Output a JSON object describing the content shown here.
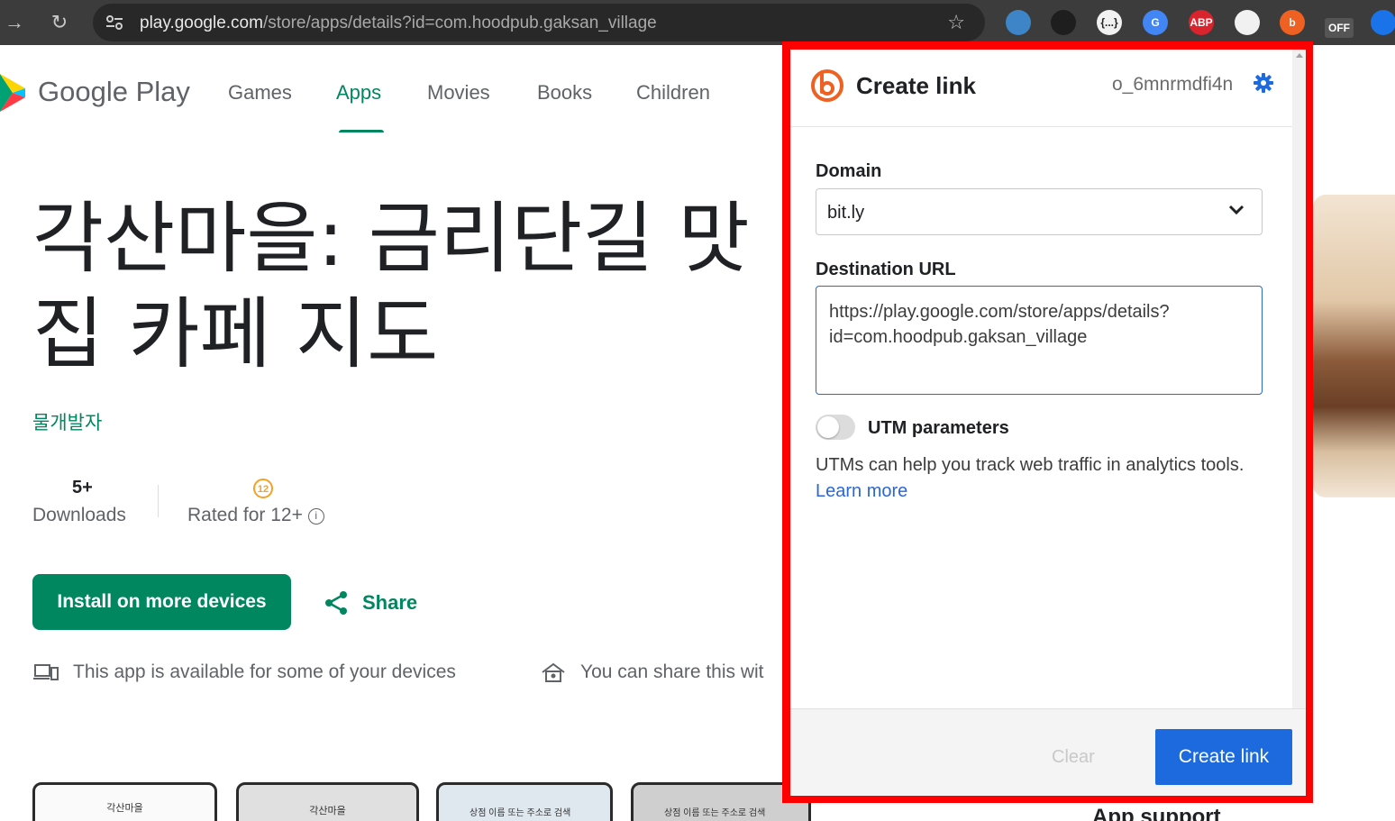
{
  "browser": {
    "url_host": "play.google.com",
    "url_path": "/store/apps/details?id=com.hoodpub.gaksan_village",
    "extensions": [
      {
        "name": "speed-dial-icon",
        "label": "",
        "color": "#3d85c6"
      },
      {
        "name": "bear-paw-icon",
        "label": "",
        "color": "#1e1e1e"
      },
      {
        "name": "json-viewer-icon",
        "label": "{...}",
        "color": "#f1f1f1"
      },
      {
        "name": "google-translate-icon",
        "label": "G",
        "color": "#4285f4"
      },
      {
        "name": "adblock-plus-icon",
        "label": "ABP",
        "color": "#d9232d"
      },
      {
        "name": "tab-manager-icon",
        "label": "",
        "color": "#f1f1f1"
      },
      {
        "name": "bitly-extension-icon",
        "label": "b",
        "color": "#ee6123"
      },
      {
        "name": "off-toggle-icon",
        "label": "OFF",
        "color": "#555555"
      },
      {
        "name": "blue-globe-icon",
        "label": "",
        "color": "#1a73e8"
      }
    ]
  },
  "play": {
    "brand": "Google Play",
    "nav": [
      "Games",
      "Apps",
      "Movies",
      "Books",
      "Children"
    ],
    "active_nav": "Apps"
  },
  "app": {
    "title": "각산마을: 금리단길 맛집 카페 지도",
    "developer": "물개발자",
    "downloads_value": "5+",
    "downloads_label": "Downloads",
    "rating_badge": "12",
    "rating_label": "Rated for 12+",
    "install_label": "Install on more devices",
    "share_label": "Share",
    "devices_note": "This app is available for some of your devices",
    "family_note": "You can share this wit",
    "app_support": "App support",
    "screenshots": [
      {
        "header": "각산마을"
      },
      {
        "header": "각산마을"
      },
      {
        "header": "상점 이름 또는 주소로 검색"
      },
      {
        "header": "상점 이름 또는 주소로 검색"
      }
    ]
  },
  "popup": {
    "title": "Create link",
    "account": "o_6mnrmdfi4n",
    "domain_label": "Domain",
    "domain_value": "bit.ly",
    "destination_label": "Destination URL",
    "destination_value": "https://play.google.com/store/apps/details?id=com.hoodpub.gaksan_village",
    "utm_label": "UTM parameters",
    "utm_enabled": false,
    "utm_description": "UTMs can help you track web traffic in analytics tools.",
    "learn_more": "Learn more",
    "clear_label": "Clear",
    "create_label": "Create link"
  },
  "colors": {
    "play_green": "#01875f",
    "bitly_orange": "#ee6123",
    "bitly_blue": "#1d6adf",
    "highlight_red": "#ff0000"
  }
}
